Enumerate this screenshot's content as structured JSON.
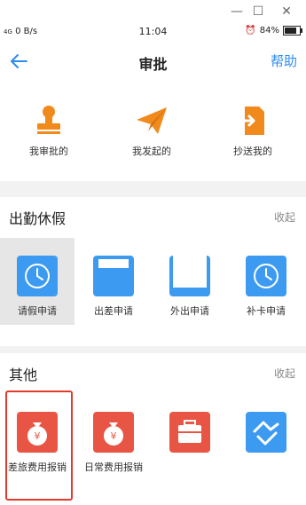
{
  "window": {
    "minimize": "—",
    "maximize": "☐",
    "close": "✕"
  },
  "status_bar": {
    "signal": "4G",
    "speed": "0 B/s",
    "time": "11:04",
    "battery": "84%",
    "battery_level": 0.84
  },
  "nav": {
    "title": "审批",
    "help": "帮助"
  },
  "top_items": [
    {
      "label": "我审批的",
      "icon": "stamp-icon"
    },
    {
      "label": "我发起的",
      "icon": "paper-plane-icon"
    },
    {
      "label": "抄送我的",
      "icon": "share-document-icon"
    }
  ],
  "attendance": {
    "title": "出勤休假",
    "collapse": "收起",
    "items": [
      {
        "label": "请假申请",
        "icon": "clock-icon"
      },
      {
        "label": "出差申请",
        "icon": "travel-icon"
      },
      {
        "label": "外出申请",
        "icon": "outing-icon"
      },
      {
        "label": "补卡申请",
        "icon": "clock-icon"
      }
    ]
  },
  "other": {
    "title": "其他",
    "collapse": "收起",
    "items": [
      {
        "label": "差旅费用报销",
        "icon": "money-bag-icon"
      },
      {
        "label": "日常费用报销",
        "icon": "money-bag-icon"
      },
      {
        "label": "",
        "icon": "toolbox-icon"
      },
      {
        "label": "",
        "icon": "handshake-icon"
      }
    ]
  },
  "colors": {
    "accent": "#2d8cf0",
    "orange": "#f08a1c",
    "tile_blue": "#3c9bf0",
    "tile_red": "#e95544",
    "highlight": "#e23b2c"
  }
}
